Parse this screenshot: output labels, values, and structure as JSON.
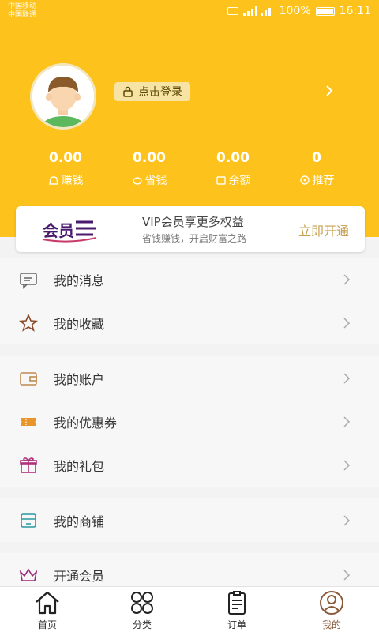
{
  "status_bar": {
    "carrier_line1": "中国移动",
    "carrier_line2": "中国联通",
    "battery": "100%",
    "time": "16:11"
  },
  "profile": {
    "login_label": "点击登录"
  },
  "stats": [
    {
      "value": "0.00",
      "label": "赚钱",
      "icon": "money-bag-icon"
    },
    {
      "value": "0.00",
      "label": "省钱",
      "icon": "piggy-icon"
    },
    {
      "value": "0.00",
      "label": "余额",
      "icon": "wallet-icon"
    },
    {
      "value": "0",
      "label": "推荐",
      "icon": "share-icon"
    }
  ],
  "vip": {
    "logo_text": "会员",
    "title": "VIP会员享更多权益",
    "subtitle": "省钱赚钱，开启财富之路",
    "button": "立即开通"
  },
  "menu": {
    "messages": "我的消息",
    "favorites": "我的收藏",
    "account": "我的账户",
    "coupons": "我的优惠券",
    "gifts": "我的礼包",
    "shop": "我的商铺",
    "membership": "开通会员"
  },
  "tabs": [
    {
      "label": "首页",
      "icon": "home-icon"
    },
    {
      "label": "分类",
      "icon": "category-icon"
    },
    {
      "label": "订单",
      "icon": "order-icon"
    },
    {
      "label": "我的",
      "icon": "profile-icon",
      "active": true
    }
  ],
  "colors": {
    "header": "#fdc31c",
    "vip_accent": "#c8a050",
    "active_tab": "#8a5a3a"
  }
}
